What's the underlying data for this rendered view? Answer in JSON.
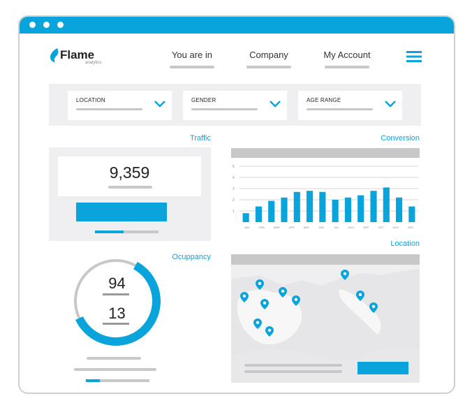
{
  "brand": {
    "name": "Flame",
    "tagline": "analytics",
    "color": "#0aa4dd"
  },
  "nav": {
    "items": [
      {
        "label": "You are in"
      },
      {
        "label": "Company"
      },
      {
        "label": "My Account"
      }
    ],
    "menu_icon": "hamburger-icon"
  },
  "filters": [
    {
      "label": "LOCATION",
      "icon": "chevron-down-icon"
    },
    {
      "label": "GENDER",
      "icon": "chevron-down-icon"
    },
    {
      "label": "AGE RANGE",
      "icon": "chevron-down-icon"
    }
  ],
  "traffic": {
    "title": "Traffic",
    "value": "9,359",
    "progress": 0.45
  },
  "occupancy": {
    "title": "Ocuppancy",
    "value_top": "94",
    "value_bottom": "13",
    "ring_fraction": 0.6,
    "progress": 0.22
  },
  "conversion": {
    "title": "Conversion"
  },
  "location": {
    "title": "Location",
    "marker_icon": "map-pin-icon",
    "marker_count": 11
  },
  "chart_data": {
    "type": "bar",
    "title": "Conversion",
    "categories": [
      "JAN",
      "FEB",
      "MAR",
      "APR",
      "MAY",
      "JUN",
      "JUL",
      "AUG",
      "SEP",
      "OCT",
      "NOV",
      "DEC"
    ],
    "values": [
      0.8,
      1.4,
      1.9,
      2.2,
      2.7,
      2.8,
      2.7,
      2.0,
      2.2,
      2.4,
      2.8,
      3.1,
      2.2,
      1.4
    ],
    "ylim": [
      0,
      5
    ],
    "yticks": [
      "1",
      "2",
      "3",
      "4",
      "5"
    ],
    "grid": true,
    "color": "#0aa4dd"
  }
}
